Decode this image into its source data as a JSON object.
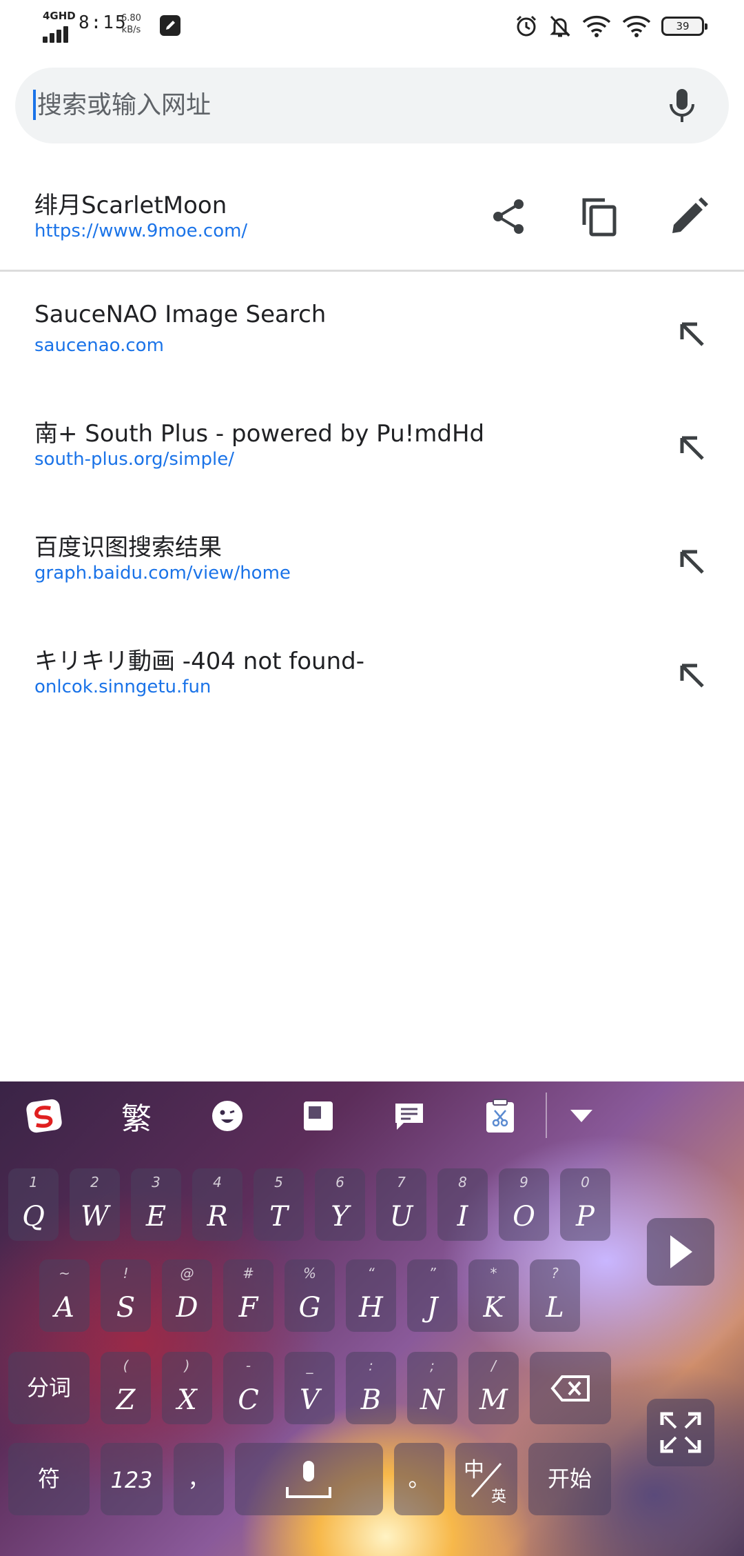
{
  "status_bar": {
    "network": "4GHD",
    "time": "8:15",
    "speed_value": "6.80",
    "speed_unit": "kB/s",
    "battery": "39",
    "icons": [
      "alarm-icon",
      "mute-bell-icon",
      "wifi-icon",
      "wifi-icon",
      "battery-icon"
    ]
  },
  "search": {
    "placeholder": "搜索或输入网址",
    "value": ""
  },
  "current_page": {
    "title": "绯月ScarletMoon",
    "url": "https://www.9moe.com/",
    "actions": [
      "share-icon",
      "copy-icon",
      "edit-icon"
    ]
  },
  "suggestions": [
    {
      "title": "SauceNAO Image Search",
      "url": "saucenao.com"
    },
    {
      "title": "南+ South Plus - powered by Pu!mdHd",
      "url": "south-plus.org/simple/"
    },
    {
      "title": "百度识图搜索结果",
      "url": "graph.baidu.com/view/home"
    },
    {
      "title": "キリキリ動画 -404 not found-",
      "url": "onlcok.sinngetu.fun"
    }
  ],
  "keyboard": {
    "toolbar": {
      "traditional": "繁"
    },
    "row1": [
      {
        "key": "Q",
        "hint": "1"
      },
      {
        "key": "W",
        "hint": "2"
      },
      {
        "key": "E",
        "hint": "3"
      },
      {
        "key": "R",
        "hint": "4"
      },
      {
        "key": "T",
        "hint": "5"
      },
      {
        "key": "Y",
        "hint": "6"
      },
      {
        "key": "U",
        "hint": "7"
      },
      {
        "key": "I",
        "hint": "8"
      },
      {
        "key": "O",
        "hint": "9"
      },
      {
        "key": "P",
        "hint": "0"
      }
    ],
    "row2": [
      {
        "key": "A",
        "hint": "~"
      },
      {
        "key": "S",
        "hint": "!"
      },
      {
        "key": "D",
        "hint": "@"
      },
      {
        "key": "F",
        "hint": "#"
      },
      {
        "key": "G",
        "hint": "%"
      },
      {
        "key": "H",
        "hint": "“"
      },
      {
        "key": "J",
        "hint": "”"
      },
      {
        "key": "K",
        "hint": "*"
      },
      {
        "key": "L",
        "hint": "?"
      }
    ],
    "row3": [
      {
        "key": "Z",
        "hint": "("
      },
      {
        "key": "X",
        "hint": ")"
      },
      {
        "key": "C",
        "hint": "-"
      },
      {
        "key": "V",
        "hint": "_"
      },
      {
        "key": "B",
        "hint": ":"
      },
      {
        "key": "N",
        "hint": ";"
      },
      {
        "key": "M",
        "hint": "/"
      }
    ],
    "segment": "分词",
    "symbols": "符",
    "numbers": "123",
    "comma": "，",
    "period": "。",
    "lang_cn": "中",
    "lang_en": "英",
    "go": "开始"
  }
}
